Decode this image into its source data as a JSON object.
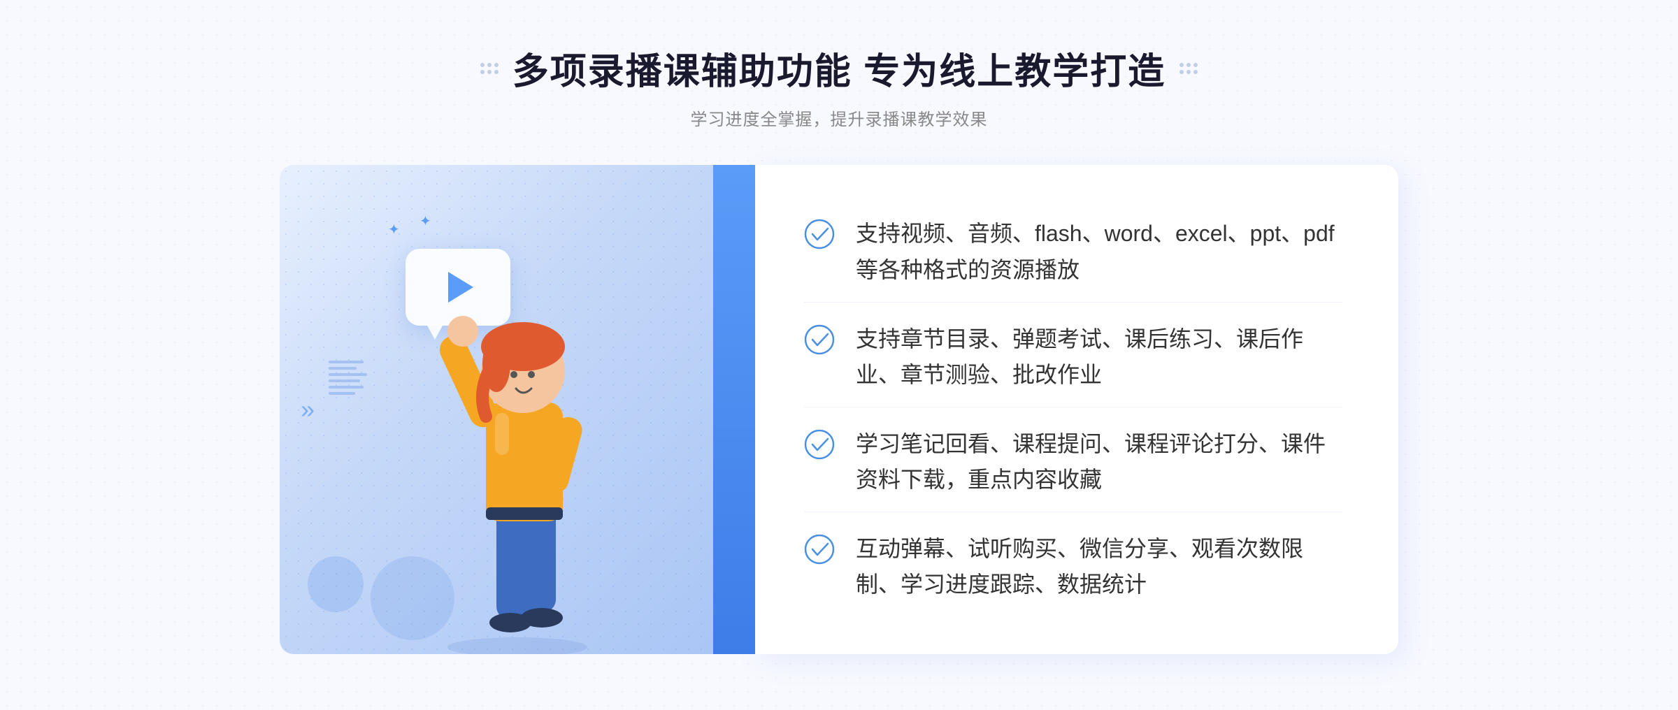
{
  "header": {
    "title": "多项录播课辅助功能 专为线上教学打造",
    "subtitle": "学习进度全掌握，提升录播课教学效果"
  },
  "features": [
    {
      "id": 1,
      "text": "支持视频、音频、flash、word、excel、ppt、pdf等各种格式的资源播放"
    },
    {
      "id": 2,
      "text": "支持章节目录、弹题考试、课后练习、课后作业、章节测验、批改作业"
    },
    {
      "id": 3,
      "text": "学习笔记回看、课程提问、课程评论打分、课件资料下载，重点内容收藏"
    },
    {
      "id": 4,
      "text": "互动弹幕、试听购买、微信分享、观看次数限制、学习进度跟踪、数据统计"
    }
  ],
  "illustration": {
    "alt": "录播课功能插图"
  }
}
